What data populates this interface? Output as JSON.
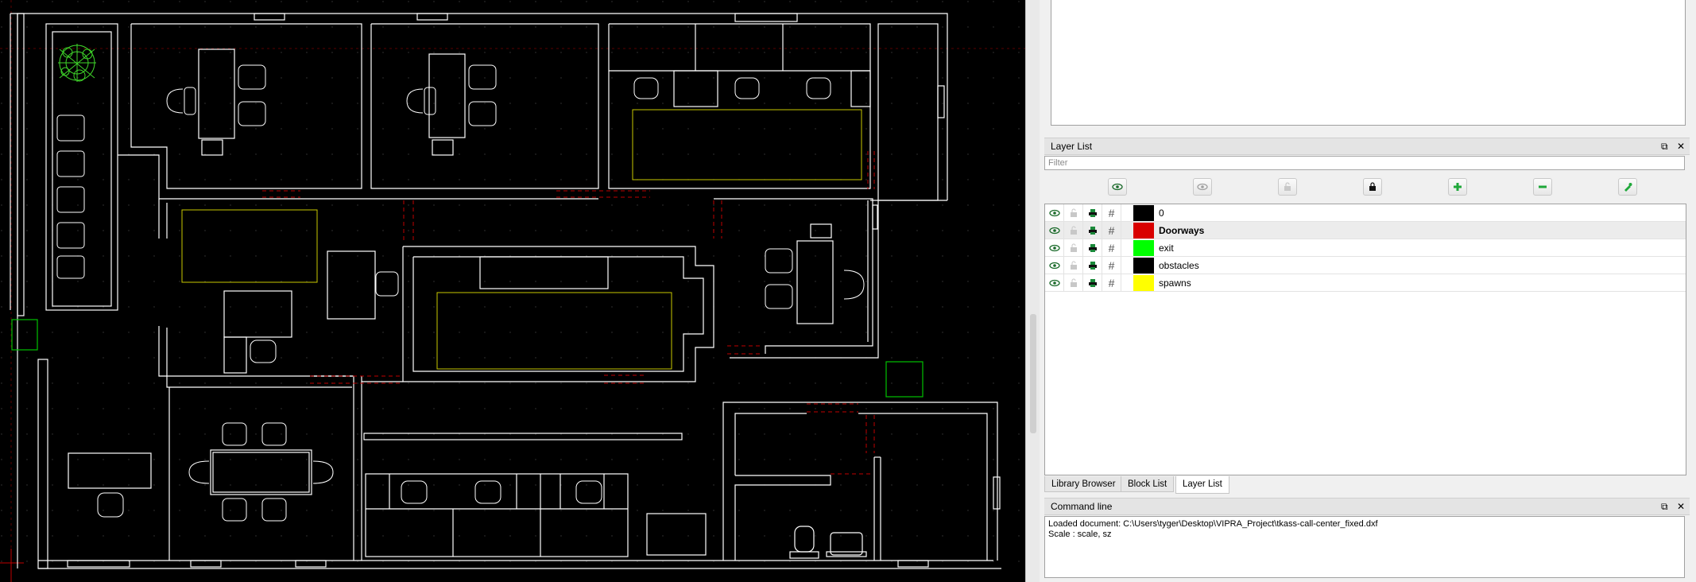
{
  "layer_list": {
    "title": "Layer List",
    "float_symbol": "⧉",
    "close_symbol": "✕",
    "filter_placeholder": "Filter",
    "toolbar": [
      {
        "name": "show-all-layers-button",
        "icon": "eye-icon"
      },
      {
        "name": "hide-all-layers-button",
        "icon": "eye-faded-icon"
      },
      {
        "name": "unlock-all-layers-button",
        "icon": "unlock-icon"
      },
      {
        "name": "lock-all-layers-button",
        "icon": "lock-icon"
      },
      {
        "name": "add-layer-button",
        "icon": "plus-icon"
      },
      {
        "name": "remove-layer-button",
        "icon": "minus-icon"
      },
      {
        "name": "edit-layer-button",
        "icon": "edit-icon"
      }
    ],
    "layers": [
      {
        "name": "0",
        "color": "#000000",
        "active": false
      },
      {
        "name": "Doorways",
        "color": "#d90000",
        "active": true
      },
      {
        "name": "exit",
        "color": "#00ff00",
        "active": false
      },
      {
        "name": "obstacles",
        "color": "#000000",
        "active": false
      },
      {
        "name": "spawns",
        "color": "#ffff00",
        "active": false
      }
    ]
  },
  "tabs": [
    {
      "label": "Library Browser",
      "selected": false
    },
    {
      "label": "Block List",
      "selected": false
    },
    {
      "label": "Layer List",
      "selected": true
    }
  ],
  "command_line": {
    "title": "Command line",
    "lines": [
      "Loaded document: C:\\Users\\tyger\\Desktop\\VIPRA_Project\\tkass-call-center_fixed.dxf",
      "Scale : scale, sz"
    ]
  },
  "colors": {
    "walls": "#ffffff",
    "doorways": "#c00000",
    "exit": "#00c000",
    "spawns": "#c8c800",
    "plant": "#3fd62a"
  }
}
